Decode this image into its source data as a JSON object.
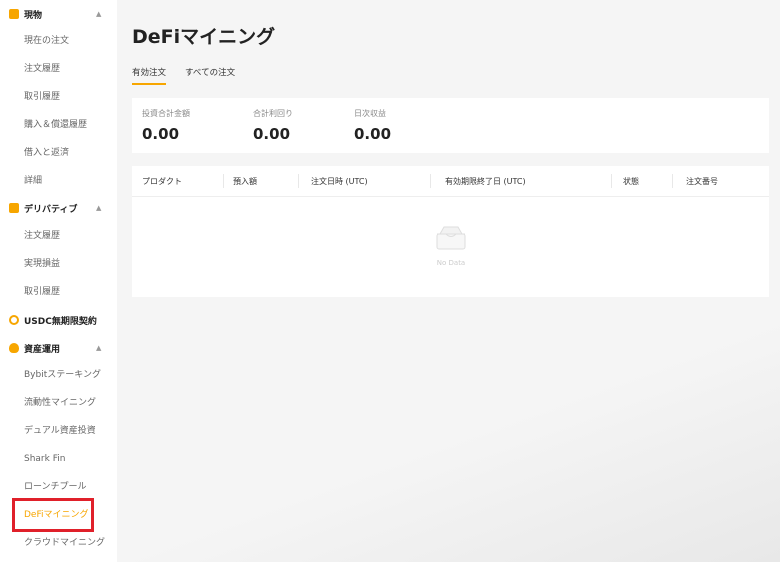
{
  "sidebar": {
    "sections": [
      {
        "label": "現物",
        "items": [
          "現在の注文",
          "注文履歴",
          "取引履歴",
          "購入＆償還履歴",
          "借入と返済",
          "詳細"
        ]
      },
      {
        "label": "デリバティブ",
        "items": [
          "注文履歴",
          "実現損益",
          "取引履歴"
        ]
      },
      {
        "label": "USDC無期限契約",
        "items": []
      },
      {
        "label": "資産運用",
        "items": [
          "Bybitステーキング",
          "流動性マイニング",
          "デュアル資産投資",
          "Shark Fin",
          "ローンチプール",
          "DeFiマイニング",
          "クラウドマイニング"
        ]
      }
    ],
    "active_item": "DeFiマイニング"
  },
  "main": {
    "title": "DeFiマイニング",
    "tabs": [
      "有効注文",
      "すべての注文"
    ],
    "active_tab": "有効注文",
    "summary": [
      {
        "label": "投資合計金額",
        "value": "0.00"
      },
      {
        "label": "合計利回り",
        "value": "0.00"
      },
      {
        "label": "日次収益",
        "value": "0.00"
      }
    ],
    "table": {
      "columns": [
        "プロダクト",
        "預入額",
        "注文日時 (UTC)",
        "有効期限終了日 (UTC)",
        "状態",
        "注文番号"
      ],
      "empty_text": "No Data"
    }
  },
  "colors": {
    "accent": "#f7a600",
    "highlight_box": "#e0202a"
  }
}
